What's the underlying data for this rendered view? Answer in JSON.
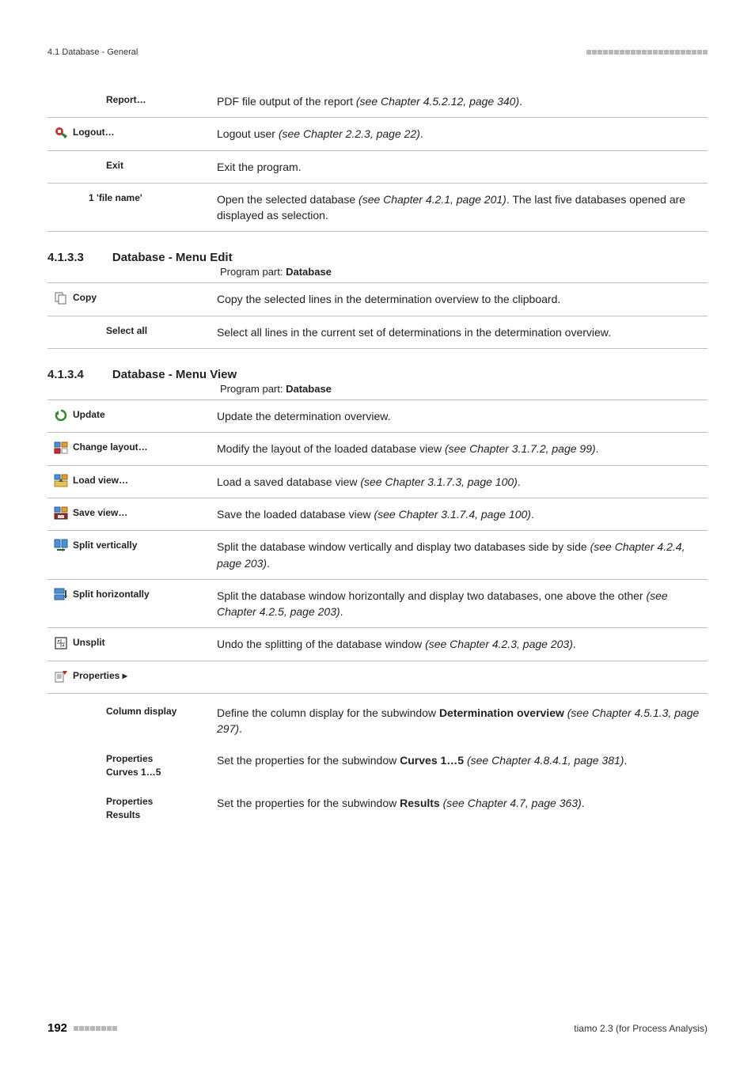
{
  "header": {
    "section_label": "4.1 Database - General"
  },
  "table1": {
    "rows": [
      {
        "icon": null,
        "label": "Report…",
        "desc_parts": [
          {
            "t": "PDF file output of the report ",
            "cls": ""
          },
          {
            "t": "(see Chapter 4.5.2.12, page 340)",
            "cls": "italic"
          },
          {
            "t": ".",
            "cls": ""
          }
        ],
        "indent": "heavy"
      },
      {
        "icon": "logout",
        "label": "Logout…",
        "desc_parts": [
          {
            "t": "Logout user ",
            "cls": ""
          },
          {
            "t": "(see Chapter 2.2.3, page 22)",
            "cls": "italic"
          },
          {
            "t": ".",
            "cls": ""
          }
        ],
        "indent": "none"
      },
      {
        "icon": null,
        "label": "Exit",
        "desc_parts": [
          {
            "t": "Exit the program.",
            "cls": ""
          }
        ],
        "indent": "heavy"
      },
      {
        "icon": null,
        "label": "1 'file name'",
        "desc_parts": [
          {
            "t": "Open the selected database ",
            "cls": ""
          },
          {
            "t": "(see Chapter 4.2.1, page 201)",
            "cls": "italic"
          },
          {
            "t": ". The last five databases opened are displayed as selection.",
            "cls": ""
          }
        ],
        "indent": "minor"
      }
    ]
  },
  "section2": {
    "num": "4.1.3.3",
    "title": "Database - Menu Edit",
    "program_prefix": "Program part: ",
    "program_bold": "Database"
  },
  "table2": {
    "rows": [
      {
        "icon": "copy",
        "label": "Copy",
        "desc_parts": [
          {
            "t": "Copy the selected lines in the determination overview to the clipboard.",
            "cls": ""
          }
        ],
        "indent": "none"
      },
      {
        "icon": null,
        "label": "Select all",
        "desc_parts": [
          {
            "t": "Select all lines in the current set of determinations in the determination overview.",
            "cls": ""
          }
        ],
        "indent": "heavy"
      }
    ]
  },
  "section3": {
    "num": "4.1.3.4",
    "title": "Database - Menu View",
    "program_prefix": "Program part: ",
    "program_bold": "Database"
  },
  "table3": {
    "rows": [
      {
        "icon": "update",
        "label": "Update",
        "desc_parts": [
          {
            "t": "Update the determination overview.",
            "cls": ""
          }
        ],
        "indent": "none"
      },
      {
        "icon": "change-layout",
        "label": "Change layout…",
        "desc_parts": [
          {
            "t": "Modify the layout of the loaded database view ",
            "cls": ""
          },
          {
            "t": "(see Chapter 3.1.7.2, page 99)",
            "cls": "italic"
          },
          {
            "t": ".",
            "cls": ""
          }
        ],
        "indent": "none"
      },
      {
        "icon": "load-view",
        "label": "Load view…",
        "desc_parts": [
          {
            "t": "Load a saved database view ",
            "cls": ""
          },
          {
            "t": "(see Chapter 3.1.7.3, page 100)",
            "cls": "italic"
          },
          {
            "t": ".",
            "cls": ""
          }
        ],
        "indent": "none"
      },
      {
        "icon": "save-view",
        "label": "Save view…",
        "desc_parts": [
          {
            "t": "Save the loaded database view ",
            "cls": ""
          },
          {
            "t": "(see Chapter 3.1.7.4, page 100)",
            "cls": "italic"
          },
          {
            "t": ".",
            "cls": ""
          }
        ],
        "indent": "none"
      },
      {
        "icon": "split-vertical",
        "label": "Split vertically",
        "desc_parts": [
          {
            "t": "Split the database window vertically and display two databases side by side ",
            "cls": ""
          },
          {
            "t": "(see Chapter 4.2.4, page 203)",
            "cls": "italic"
          },
          {
            "t": ".",
            "cls": ""
          }
        ],
        "indent": "none"
      },
      {
        "icon": "split-horizontal",
        "label": "Split horizontally",
        "desc_parts": [
          {
            "t": "Split the database window horizontally and display two databases, one above the other ",
            "cls": ""
          },
          {
            "t": "(see Chapter 4.2.5, page 203)",
            "cls": "italic"
          },
          {
            "t": ".",
            "cls": ""
          }
        ],
        "indent": "none"
      },
      {
        "icon": "unsplit",
        "label": "Unsplit",
        "desc_parts": [
          {
            "t": "Undo the splitting of the database window ",
            "cls": ""
          },
          {
            "t": "(see Chapter 4.2.3, page 203)",
            "cls": "italic"
          },
          {
            "t": ".",
            "cls": ""
          }
        ],
        "indent": "none"
      },
      {
        "icon": "properties",
        "label": "Properties ▸",
        "desc_parts": [],
        "indent": "none"
      }
    ]
  },
  "table3_submenu": [
    {
      "label": "Column display",
      "desc_parts": [
        {
          "t": "Define the column display for the subwindow ",
          "cls": ""
        },
        {
          "t": "Determination overview",
          "cls": "bold"
        },
        {
          "t": " ",
          "cls": ""
        },
        {
          "t": "(see Chapter 4.5.1.3, page 297)",
          "cls": "italic"
        },
        {
          "t": ".",
          "cls": ""
        }
      ]
    },
    {
      "label": "Properties\nCurves 1…5",
      "desc_parts": [
        {
          "t": "Set the properties for the subwindow ",
          "cls": ""
        },
        {
          "t": "Curves 1…5",
          "cls": "bold"
        },
        {
          "t": " ",
          "cls": ""
        },
        {
          "t": "(see Chapter 4.8.4.1, page 381)",
          "cls": "italic"
        },
        {
          "t": ".",
          "cls": ""
        }
      ]
    },
    {
      "label": "Properties\nResults",
      "desc_parts": [
        {
          "t": "Set the properties for the subwindow ",
          "cls": ""
        },
        {
          "t": "Results",
          "cls": "bold"
        },
        {
          "t": " ",
          "cls": ""
        },
        {
          "t": "(see Chapter 4.7, page 363)",
          "cls": "italic"
        },
        {
          "t": ".",
          "cls": ""
        }
      ]
    }
  ],
  "footer": {
    "page_number": "192",
    "product": "tiamo 2.3 (for Process Analysis)"
  },
  "icons": {
    "logout": "logout-icon",
    "copy": "copy-icon",
    "update": "update-icon",
    "change-layout": "change-layout-icon",
    "load-view": "load-view-icon",
    "save-view": "save-view-icon",
    "split-vertical": "split-vertical-icon",
    "split-horizontal": "split-horizontal-icon",
    "unsplit": "unsplit-icon",
    "properties": "properties-icon"
  }
}
